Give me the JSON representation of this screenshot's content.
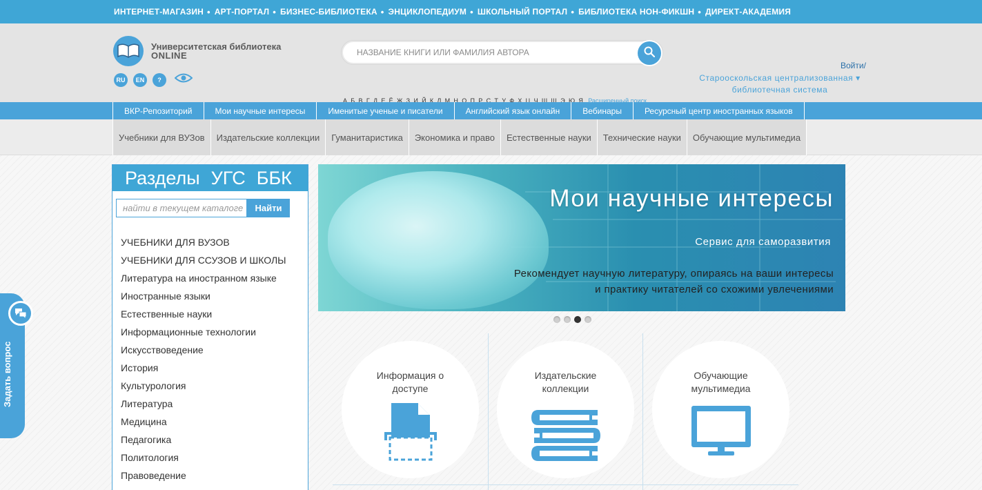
{
  "topbar": {
    "links": [
      "ИНТЕРНЕТ-МАГАЗИН",
      "АРТ-ПОРТАЛ",
      "БИЗНЕС-БИБЛИОТЕКА",
      "ЭНЦИКЛОПЕДИУМ",
      "ШКОЛЬНЫЙ ПОРТАЛ",
      "БИБЛИОТЕКА НОН-ФИКШН",
      "ДИРЕКТ-АКАДЕМИЯ"
    ]
  },
  "header": {
    "logo_line1": "Университетская библиотека",
    "logo_line2": "ONLINE",
    "langs": [
      "RU",
      "EN",
      "?"
    ],
    "search_placeholder": "НАЗВАНИЕ КНИГИ ИЛИ ФАМИЛИЯ АВТОРА",
    "alphabet": "А Б В Г Д Е Ё Ж З И Й К Л М Н О П Р С Т У Ф Х Ц Ч Ш Щ Э Ю Я",
    "advanced_search": "Расширенный поиск",
    "login": "Войти/",
    "library_line1": "Старооскольская централизованная ▾",
    "library_line2": "библиотечная система"
  },
  "nav1": [
    "ВКР-Репозиторий",
    "Мои научные интересы",
    "Именитые ученые и писатели",
    "Английский язык онлайн",
    "Вебинары",
    "Ресурсный центр иностранных языков"
  ],
  "nav2": [
    "Учебники для ВУЗов",
    "Издательские коллекции",
    "Гуманитаристика",
    "Экономика и право",
    "Естественные науки",
    "Технические науки",
    "Обучающие мультимедиа"
  ],
  "sidebar": {
    "tabs": [
      "Разделы",
      "УГС",
      "ББК"
    ],
    "search_placeholder": "найти в текущем каталоге",
    "search_button": "Найти",
    "items": [
      "УЧЕБНИКИ ДЛЯ ВУЗОВ",
      "УЧЕБНИКИ ДЛЯ ССУЗОВ И ШКОЛЫ",
      "Литература на иностранном языке",
      "Иностранные языки",
      "Естественные науки",
      "Информационные технологии",
      "Искусствоведение",
      "История",
      "Культурология",
      "Литература",
      "Медицина",
      "Педагогика",
      "Политология",
      "Правоведение"
    ]
  },
  "banner": {
    "title": "Мои научные интересы",
    "subtitle": "Сервис для саморазвития",
    "desc_line1": "Рекомендует научную литературу, опираясь на ваши интересы",
    "desc_line2": "и практику читателей со схожими увлечениями",
    "active_slide": 3,
    "slide_count": 4
  },
  "features": [
    {
      "label": "Информация о доступе",
      "icon": "document-scan-icon"
    },
    {
      "label": "Издательские коллекции",
      "icon": "books-stack-icon"
    },
    {
      "label": "Обучающие мультимедиа",
      "icon": "monitor-icon"
    }
  ],
  "ask": {
    "label": "Задать вопрос",
    "icon": "chat-bubbles-icon"
  },
  "colors": {
    "accent": "#4aa3d9",
    "topbar": "#3fa6d6",
    "header_bg": "#e4e4e4"
  }
}
